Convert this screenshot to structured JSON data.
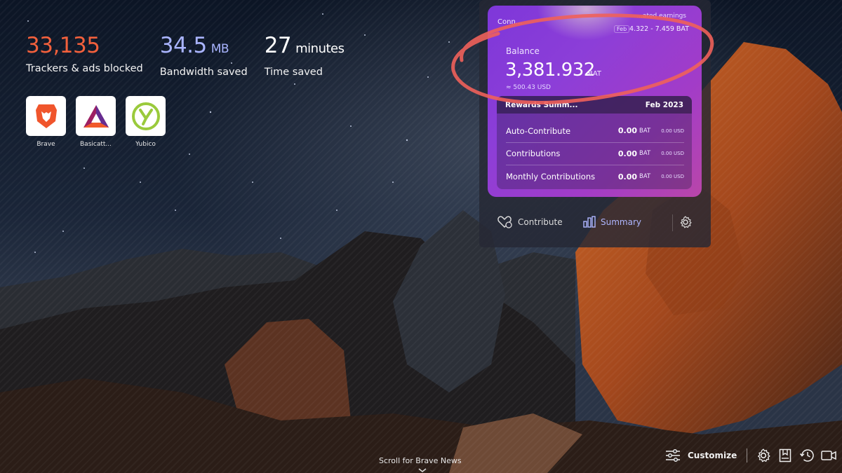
{
  "stats": {
    "trackers": {
      "value": "33,135",
      "label": "Trackers & ads blocked"
    },
    "bandwidth": {
      "value": "34.5",
      "unit": "MB",
      "label": "Bandwidth saved"
    },
    "time": {
      "value": "27",
      "unit": "minutes",
      "label": "Time saved"
    }
  },
  "top_sites": [
    {
      "name": "Brave",
      "icon": "brave-lion-icon"
    },
    {
      "name": "Basicatt...",
      "icon": "bat-triangle-icon"
    },
    {
      "name": "Yubico",
      "icon": "yubico-icon"
    }
  ],
  "rewards": {
    "connected_label": "Conn...",
    "estimated_label": "...ated earnings",
    "estimated_month": "Feb",
    "estimated_range": "4.322 - 7.459 BAT",
    "balance_label": "Balance",
    "balance_value": "3,381.932",
    "balance_unit": "BAT",
    "balance_usd": "≈ 500.43 USD",
    "summary_title": "Rewards Summ...",
    "summary_month": "Feb 2023",
    "summary_rows": [
      {
        "label": "Auto-Contribute",
        "amount": "0.00",
        "unit": "BAT",
        "usd": "0.00 USD"
      },
      {
        "label": "Contributions",
        "amount": "0.00",
        "unit": "BAT",
        "usd": "0.00 USD"
      },
      {
        "label": "Monthly Contributions",
        "amount": "0.00",
        "unit": "BAT",
        "usd": "0.00 USD"
      }
    ],
    "actions": {
      "contribute": "Contribute",
      "summary": "Summary"
    }
  },
  "bottom": {
    "scroll_news": "Scroll for Brave News",
    "customize": "Customize",
    "icons": [
      "settings-icon",
      "bookmarks-icon",
      "history-icon",
      "video-icon"
    ]
  },
  "colors": {
    "trackers": "#f2603c",
    "bandwidth": "#a9b4ff",
    "accent_summary": "#aeb6ff",
    "annotation_circle": "#f0605a"
  }
}
